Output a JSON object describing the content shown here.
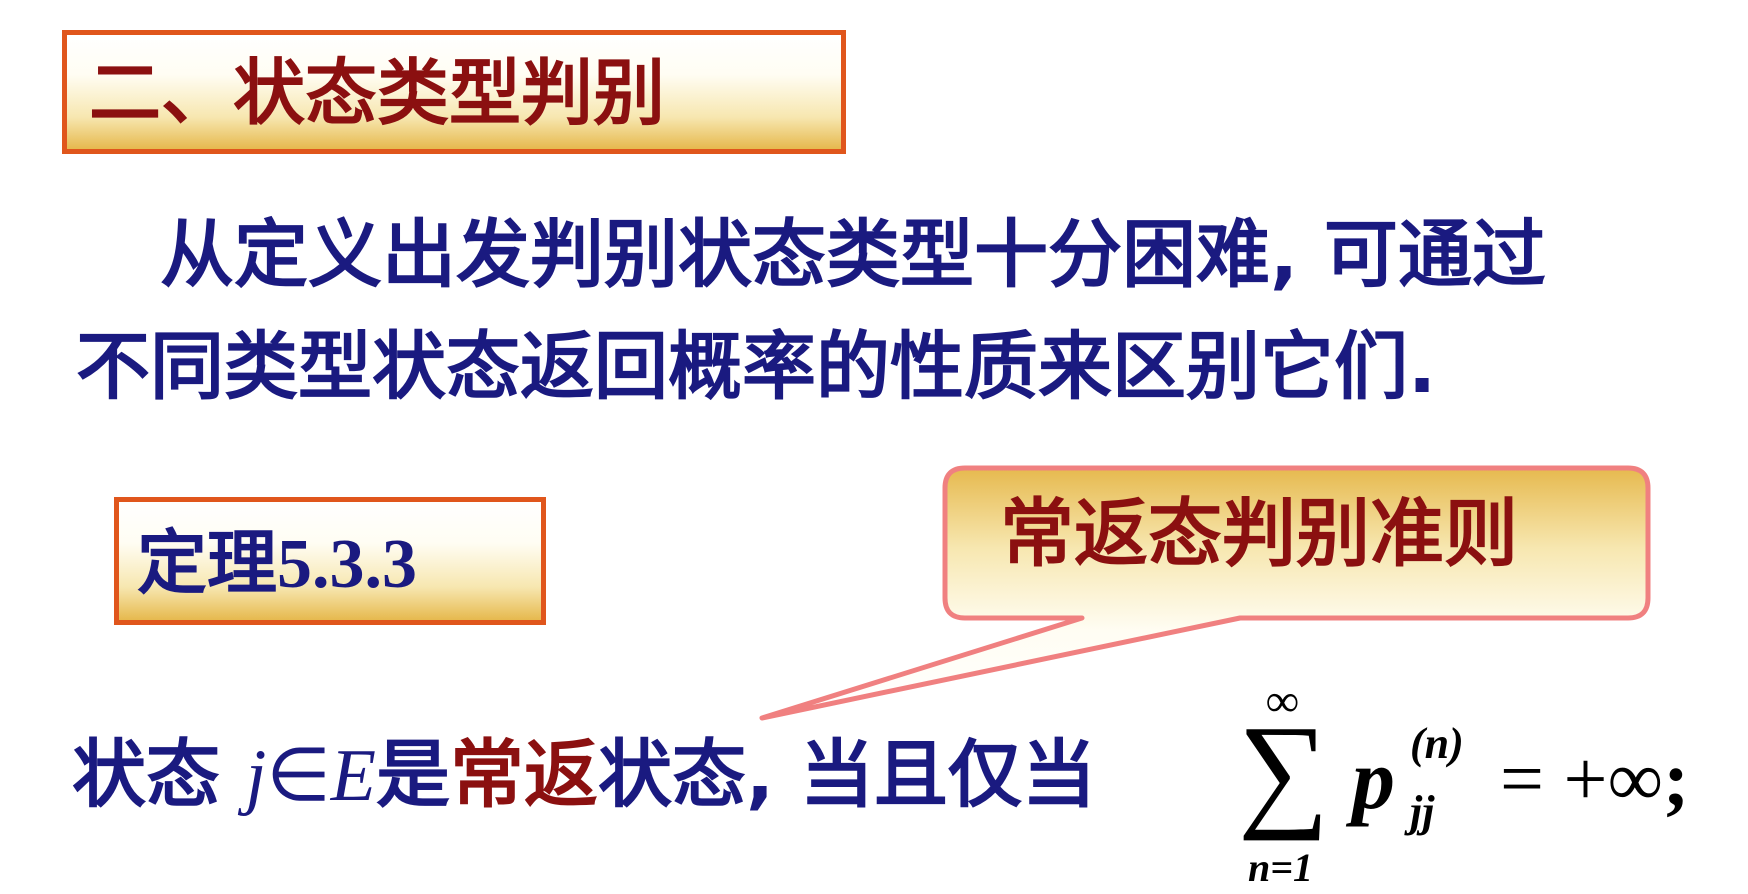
{
  "section_title": "二、状态类型判别",
  "intro": {
    "line1": "从定义出发判别状态类型十分困难, 可通过",
    "line2": "不同类型状态返回概率的性质来区别它们."
  },
  "theorem": {
    "label_cn": "定理",
    "label_num": "5.3.3"
  },
  "callout": {
    "text": "常返态判别准则"
  },
  "statement": {
    "prefix": "状态",
    "var": "j",
    "in": "∈",
    "set": "E",
    "is": "是",
    "highlight": "常返",
    "suffix": "状态, 当且仅当"
  },
  "formula": {
    "sum_upper": "∞",
    "sum_symbol": "∑",
    "sum_lower": "n=1",
    "term": "p",
    "term_sup": "(n)",
    "term_sub": "jj",
    "rhs": "= +∞",
    "end": ";"
  },
  "colors": {
    "heading": "#8b1010",
    "body": "#1a1a80",
    "box_border": "#e0561c",
    "callout_border": "#f08080",
    "box_gradient_end": "#e6b94e"
  }
}
